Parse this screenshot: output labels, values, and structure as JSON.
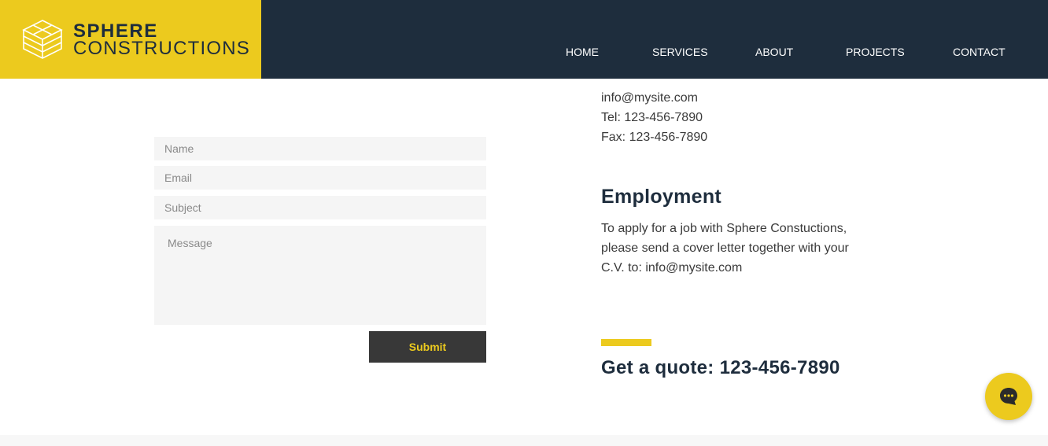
{
  "brand": {
    "name_line1": "SPHERE",
    "name_line2": "CONSTRUCTIONS",
    "logo_icon": "stacked-cube-icon"
  },
  "nav": {
    "items": [
      {
        "label": "HOME"
      },
      {
        "label": "SERVICES"
      },
      {
        "label": "ABOUT"
      },
      {
        "label": "PROJECTS"
      },
      {
        "label": "CONTACT"
      }
    ]
  },
  "form": {
    "name_placeholder": "Name",
    "email_placeholder": "Email",
    "subject_placeholder": "Subject",
    "message_placeholder": "Message",
    "submit_label": "Submit"
  },
  "contact": {
    "email": "info@mysite.com",
    "tel": "Tel: 123-456-7890",
    "fax": "Fax: 123-456-7890"
  },
  "employment": {
    "title": "Employment",
    "lines": [
      "To apply for a job with Sphere Constuctions,",
      "please send a cover letter together with your",
      "C.V. to: info@mysite.com"
    ]
  },
  "quote": {
    "text": "Get a quote: 123-456-7890"
  },
  "chat": {
    "icon": "chat-bubble-icon"
  },
  "colors": {
    "accent": "#ecca1e",
    "navy": "#1e2d3d",
    "button_dark": "#383838"
  }
}
